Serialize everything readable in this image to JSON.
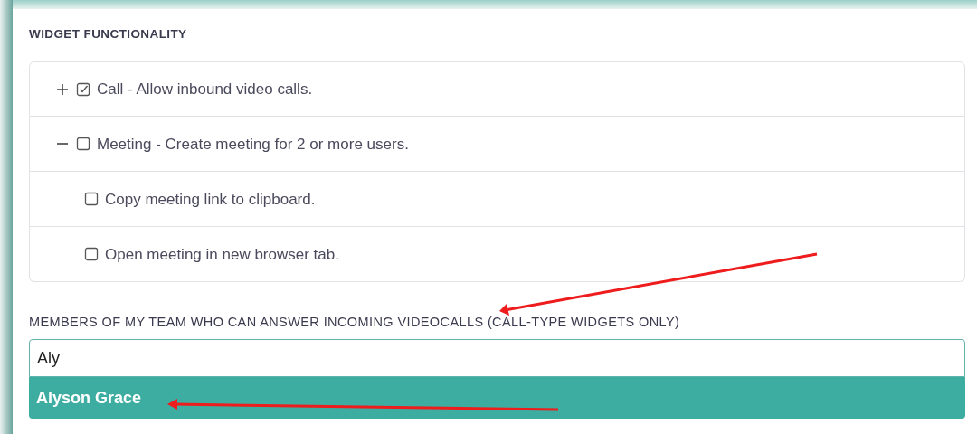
{
  "section_title": "WIDGET FUNCTIONALITY",
  "features": [
    {
      "label": "Call - Allow inbound video calls.",
      "checked": true,
      "expanded": false
    },
    {
      "label": "Meeting - Create meeting for 2 or more users.",
      "checked": false,
      "expanded": true,
      "children": [
        {
          "label": "Copy meeting link to clipboard.",
          "checked": false
        },
        {
          "label": "Open meeting in new browser tab.",
          "checked": false
        }
      ]
    }
  ],
  "members": {
    "label": "MEMBERS OF MY TEAM WHO CAN ANSWER INCOMING VIDEOCALLS (CALL-TYPE WIDGETS ONLY)",
    "value": "Aly",
    "suggestions": [
      {
        "label": "Alyson Grace",
        "selected": true
      }
    ]
  }
}
